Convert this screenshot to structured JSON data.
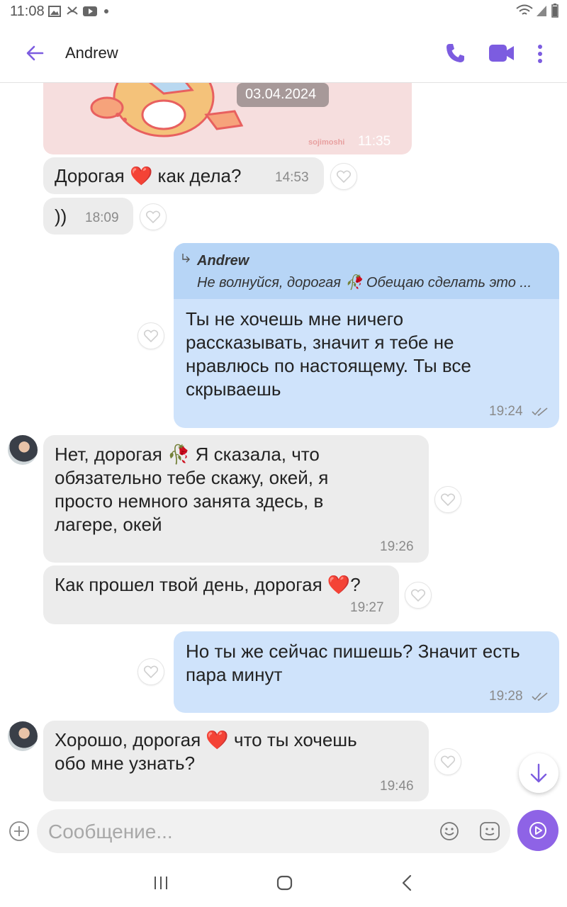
{
  "status_bar": {
    "time": "11:08"
  },
  "header": {
    "contact_name": "Andrew"
  },
  "image_message": {
    "date_badge": "03.04.2024",
    "time": "11:35",
    "watermark": "sojimoshi"
  },
  "messages": [
    {
      "direction": "in",
      "text": "Дорогая ❤️ как дела?",
      "time": "14:53"
    },
    {
      "direction": "in",
      "text": "))",
      "time": "18:09"
    },
    {
      "direction": "out",
      "reply_to": {
        "author": "Andrew",
        "preview": "Не волнуйся, дорогая 🥀 Обещаю сделать это ..."
      },
      "text": "Ты не хочешь мне ничего\nрассказывать, значит я тебе не\nнравлюсь по настоящему.  Ты все\nскрываешь",
      "time": "19:24"
    },
    {
      "direction": "in",
      "text": "Нет, дорогая 🥀 Я сказала, что\nобязательно тебе скажу, окей, я\nпросто немного занята здесь, в\nлагере, окей",
      "time": "19:26"
    },
    {
      "direction": "in",
      "text": "Как прошел твой день, дорогая ❤️?",
      "time": "19:27"
    },
    {
      "direction": "out",
      "text": "Но ты же сейчас пишешь? Значит есть\nпара минут",
      "time": "19:28"
    },
    {
      "direction": "in",
      "text": "Хорошо, дорогая ❤️ что ты хочешь\nобо мне узнать?",
      "time": "19:46"
    }
  ],
  "composer": {
    "placeholder": "Сообщение..."
  },
  "colors": {
    "accent": "#7c5ce0",
    "incoming_bubble": "#ececec",
    "outgoing_bubble": "#cfe3fb",
    "reply_header": "#b7d5f6",
    "send_button": "#8e63e6"
  },
  "icons": [
    "back-arrow-icon",
    "phone-icon",
    "video-call-icon",
    "more-vertical-icon",
    "heart-icon",
    "double-check-icon",
    "reply-arrow-icon",
    "add-icon",
    "emoji-icon",
    "sticker-icon",
    "send-voice-icon",
    "arrow-down-icon",
    "nav-recents-icon",
    "nav-home-icon",
    "nav-back-icon"
  ]
}
